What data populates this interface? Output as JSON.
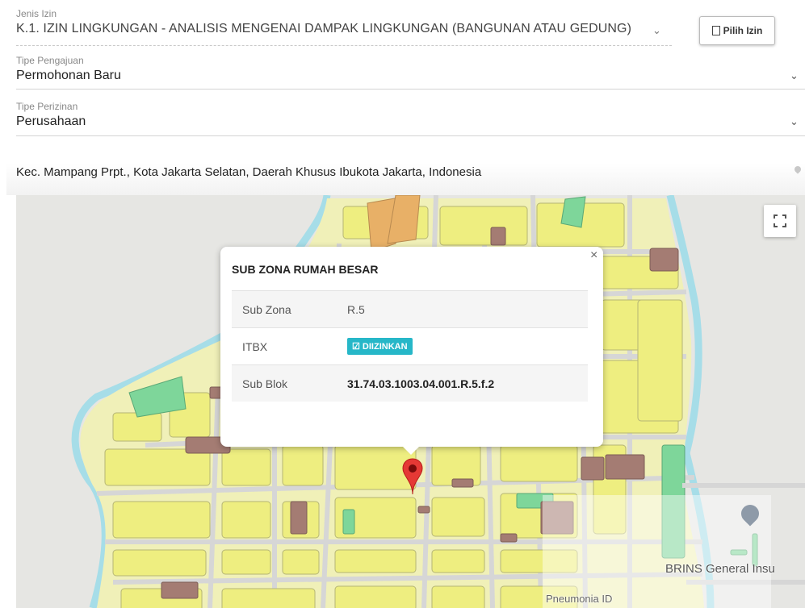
{
  "form": {
    "jenis_izin": {
      "label": "Jenis Izin",
      "value": "K.1. IZIN LINGKUNGAN - ANALISIS MENGENAI DAMPAK LINGKUNGAN (BANGUNAN ATAU GEDUNG)"
    },
    "pilih_izin_button": "Pilih Izin",
    "tipe_pengajuan": {
      "label": "Tipe Pengajuan",
      "value": "Permohonan Baru"
    },
    "tipe_perizinan": {
      "label": "Tipe Perizinan",
      "value": "Perusahaan"
    },
    "chevron": "⌄",
    "address": "Kec. Mampang Prpt., Kota Jakarta Selatan, Daerah Khusus Ibukota Jakarta, Indonesia"
  },
  "popup": {
    "close": "×",
    "title": "SUB ZONA RUMAH BESAR",
    "rows": [
      {
        "key": "Sub Zona",
        "value": "R.5"
      },
      {
        "key": "ITBX",
        "badge": "☑ DIIZINKAN",
        "badge_color": "#26b7c8"
      },
      {
        "key": "Sub Blok",
        "value": "31.74.03.1003.04.001.R.5.f.2"
      }
    ]
  },
  "map": {
    "pois": [
      "BRINS General Insu",
      "Pneumonia ID"
    ],
    "colors": {
      "residential": "#eeee80",
      "green": "#7ed69a",
      "orange": "#e8b067",
      "brown": "#a47c73",
      "water": "#a6dde8",
      "road": "#d8d8d8",
      "marker": "#e53935"
    }
  },
  "icons": [
    "chevron-down-icon",
    "document-icon",
    "location-pin-icon",
    "fullscreen-icon",
    "close-icon",
    "map-marker-icon",
    "poi-education-icon"
  ]
}
